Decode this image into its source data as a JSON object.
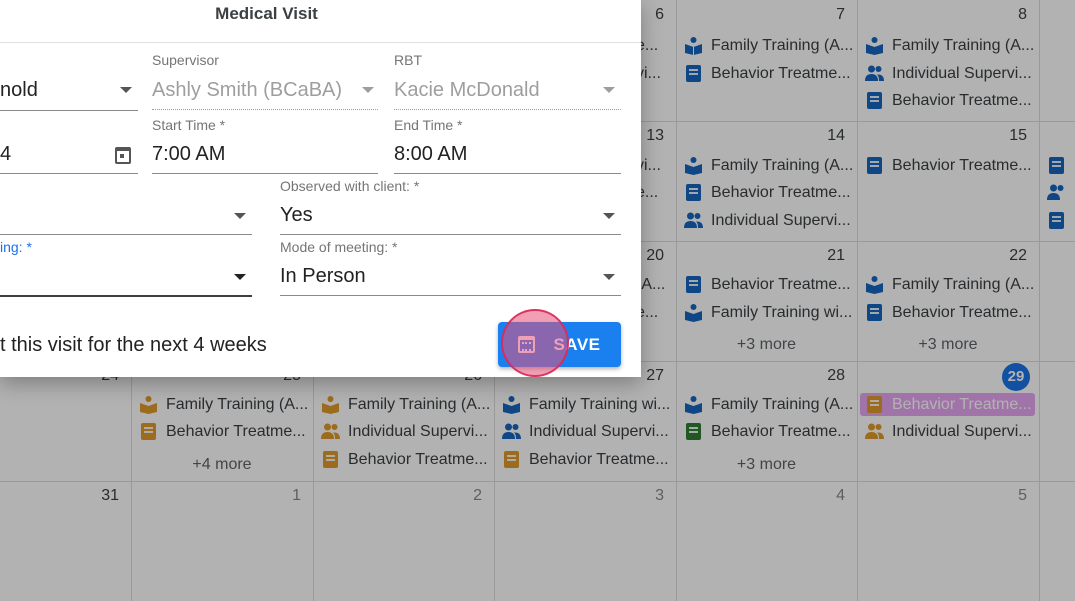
{
  "dialog": {
    "title": "Medical Visit",
    "fields": {
      "client_value": "nold",
      "supervisor_label": "Supervisor",
      "supervisor_value": "Ashly Smith (BCaBA)",
      "rbt_label": "RBT",
      "rbt_value": "Kacie McDonald",
      "date_value": "4",
      "start_time_label": "Start Time *",
      "start_time_value": "7:00 AM",
      "end_time_label": "End Time *",
      "end_time_value": "8:00 AM",
      "observed_label": "Observed with client: *",
      "observed_value": "Yes",
      "meeting_label_partial": "ing: *",
      "mode_label": "Mode of meeting: *",
      "mode_value": "In Person"
    },
    "repeat_text": "t this visit for the next 4 weeks",
    "save_label": "SAVE"
  },
  "calendar": {
    "colors": {
      "blue": "#1565c0",
      "orange": "#e09a2a",
      "green": "#2e7d32",
      "highlight": "#e7a7f2",
      "today": "#1a73e8"
    },
    "week1": {
      "d6": {
        "day": "6",
        "events": [
          "e...",
          "vi..."
        ]
      },
      "d7": {
        "day": "7",
        "events": [
          "Family Training (A...",
          "Behavior Treatme..."
        ]
      },
      "d8": {
        "day": "8",
        "events": [
          "Family Training (A...",
          "Individual Supervi...",
          "Behavior Treatme..."
        ]
      }
    },
    "week2": {
      "d13": {
        "day": "13",
        "events": [
          "vi...",
          "e..."
        ]
      },
      "d14": {
        "day": "14",
        "events": [
          "Family Training (A...",
          "Behavior Treatme...",
          "Individual Supervi..."
        ]
      },
      "d15": {
        "day": "15",
        "events": [
          "Behavior Treatme..."
        ]
      }
    },
    "week3": {
      "d20": {
        "day": "20",
        "events": [
          "(A...",
          "e..."
        ]
      },
      "d21": {
        "day": "21",
        "events": [
          "Behavior Treatme...",
          "Family Training wi..."
        ],
        "more": "+3 more"
      },
      "d22": {
        "day": "22",
        "events": [
          "Family Training (A...",
          "Behavior Treatme..."
        ],
        "more": "+3 more"
      }
    },
    "week4": {
      "d24": {
        "day": "24"
      },
      "d25": {
        "day": "25",
        "events": [
          "Family Training (A...",
          "Behavior Treatme..."
        ],
        "more": "+4 more"
      },
      "d26": {
        "day": "26",
        "events": [
          "Family Training (A...",
          "Individual Supervi...",
          "Behavior Treatme..."
        ]
      },
      "d27": {
        "day": "27",
        "events": [
          "Family Training wi...",
          "Individual Supervi...",
          "Behavior Treatme..."
        ]
      },
      "d28": {
        "day": "28",
        "events": [
          "Family Training (A...",
          "Behavior Treatme..."
        ],
        "more": "+3 more"
      },
      "d29": {
        "day": "29",
        "events": [
          "Behavior Treatme...",
          "Individual Supervi..."
        ]
      }
    },
    "week5": {
      "d31": {
        "day": "31"
      },
      "d1": {
        "day": "1"
      },
      "d2": {
        "day": "2"
      },
      "d3": {
        "day": "3"
      },
      "d4": {
        "day": "4"
      },
      "d5": {
        "day": "5"
      }
    }
  }
}
